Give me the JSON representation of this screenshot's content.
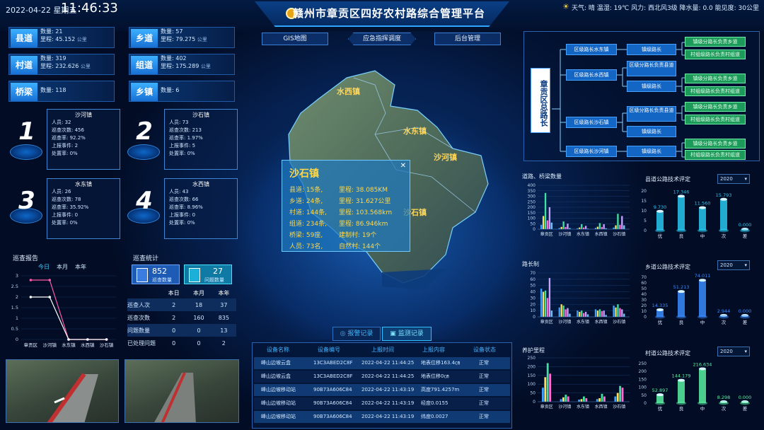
{
  "header": {
    "date": "2022-04-22",
    "weekday": "星期五",
    "time": "11:46:33",
    "title": "赣州市章贡区四好农村路综合管理平台",
    "weather": "天气: 晴  温湿: 19℃  风力: 西北风3级  降水量: 0.0  能见度: 30公里"
  },
  "tabs": [
    {
      "label": "GIS地图"
    },
    {
      "label": "应急指挥调度"
    },
    {
      "label": "后台管理"
    }
  ],
  "stats": [
    {
      "name": "县道",
      "l1": "数量: 21",
      "l2": "里程: 45.152",
      "u": "公里"
    },
    {
      "name": "乡道",
      "l1": "数量: 57",
      "l2": "里程: 79.275",
      "u": "公里"
    },
    {
      "name": "村道",
      "l1": "数量: 319",
      "l2": "里程: 232.626",
      "u": "公里"
    },
    {
      "name": "组道",
      "l1": "数量: 402",
      "l2": "里程: 175.289",
      "u": "公里"
    },
    {
      "name": "桥梁",
      "l1": "数量: 118",
      "l2": "",
      "u": ""
    },
    {
      "name": "乡镇",
      "l1": "数量: 6",
      "l2": "",
      "u": ""
    }
  ],
  "towns": [
    {
      "rank": "1",
      "name": "沙河镇",
      "people": "人员: 32",
      "times": "巡查次数: 456",
      "rate": "巡查率: 92.2%",
      "report": "上报事件: 2",
      "handle": "处置率: 0%"
    },
    {
      "rank": "2",
      "name": "沙石镇",
      "people": "人员: 73",
      "times": "巡查次数: 213",
      "rate": "巡查率: 1.97%",
      "report": "上报事件: 5",
      "handle": "处置率: 0%"
    },
    {
      "rank": "3",
      "name": "水东镇",
      "people": "人员: 26",
      "times": "巡查次数: 78",
      "rate": "巡查率: 35.92%",
      "report": "上报事件: 0",
      "handle": "处置率: 0%"
    },
    {
      "rank": "4",
      "name": "水西镇",
      "people": "人员: 43",
      "times": "巡查次数: 66",
      "rate": "巡查率: 8.96%",
      "report": "上报事件: 0",
      "handle": "处置率: 0%"
    }
  ],
  "patrol_report": {
    "title": "巡查报告",
    "tabs": [
      "今日",
      "本月",
      "本年"
    ],
    "yticks": [
      "3",
      "2.5",
      "2",
      "1.5",
      "1",
      "0.5",
      "0"
    ],
    "categories": [
      "章贡区",
      "沙河镇",
      "水东镇",
      "水西镇",
      "沙石镇"
    ]
  },
  "patrol_stats": {
    "title": "巡查统计",
    "count": "852",
    "count_label": "巡查数量",
    "issues": "27",
    "issues_label": "问题数量",
    "headers": [
      "",
      "本日",
      "本月",
      "本年"
    ],
    "rows": [
      [
        "巡查人次",
        "2",
        "18",
        "37"
      ],
      [
        "巡查次数",
        "2",
        "160",
        "835"
      ],
      [
        "问题数量",
        "0",
        "0",
        "13"
      ],
      [
        "已处理问题",
        "0",
        "0",
        "2"
      ]
    ]
  },
  "map": {
    "labels": [
      "水西镇",
      "水东镇",
      "沙河镇",
      "沙石镇"
    ],
    "popup": {
      "title": "沙石镇",
      "rows": [
        [
          "县道: 15条,",
          "里程: 38.085KM"
        ],
        [
          "乡道: 24条,",
          "里程: 31.627公里"
        ],
        [
          "村道: 144条,",
          "里程: 103.568km"
        ],
        [
          "组道: 234条,",
          "里程: 86.946km"
        ],
        [
          "桥梁: 59座,",
          "建制村: 19个"
        ],
        [
          "人员: 73名,",
          "自然村: 144个"
        ]
      ]
    }
  },
  "records": {
    "tab1": "报警记录",
    "tab2": "监测记录",
    "headers": [
      "设备名称",
      "设备编号",
      "上报时间",
      "上报内容",
      "设备状态"
    ],
    "rows": [
      [
        "峰山边坡云盒",
        "13C3ABED2C8F",
        "2022-04-22 11:44:25",
        "地表位移163.4㎝",
        "正常"
      ],
      [
        "峰山边坡云盒",
        "13C3ABED2C8F",
        "2022-04-22 11:44:25",
        "地表位移0㎝",
        "正常"
      ],
      [
        "峰山边坡移动站",
        "90B73A606C84",
        "2022-04-22 11:43:19",
        "高度791.4257m",
        "正常"
      ],
      [
        "峰山边坡移动站",
        "90B73A606C84",
        "2022-04-22 11:43:19",
        "经度0.0155",
        "正常"
      ],
      [
        "峰山边坡移动站",
        "90B73A606C84",
        "2022-04-22 11:43:19",
        "纬度0.0027",
        "正常"
      ]
    ]
  },
  "org": {
    "root": "章贡区总路长",
    "district": [
      "区级路长水东镇",
      "区级路长水西镇",
      "区级路长沙石镇",
      "区级路长沙河镇"
    ],
    "town": [
      "镇级路长",
      "区级分路长负责县道",
      "镇级路长",
      "区级分路长负责县道",
      "镇级路长",
      "镇级路长"
    ],
    "village": [
      "镇级分路长负责乡道",
      "村组级路长负责村组道",
      "镇级分路长负责乡道",
      "村组级路长负责村组道",
      "镇级分路长负责乡道",
      "村组级路长负责村组道",
      "镇级分路长负责乡道",
      "村组级路长负责村组道"
    ]
  },
  "selects": {
    "year": "2020"
  },
  "chart_data": [
    {
      "type": "bar",
      "title": "道路、桥梁数量",
      "categories": [
        "章贡区",
        "沙河镇",
        "水东镇",
        "水西镇",
        "沙石镇"
      ],
      "ylim": [
        0,
        400
      ],
      "yticks": [
        "400",
        "350",
        "300",
        "250",
        "200",
        "150",
        "100",
        "50",
        "0"
      ],
      "series": [
        {
          "values": [
            40,
            10,
            8,
            12,
            15
          ]
        },
        {
          "values": [
            120,
            20,
            15,
            22,
            35
          ]
        },
        {
          "values": [
            330,
            70,
            45,
            55,
            140
          ]
        },
        {
          "values": [
            80,
            20,
            15,
            20,
            40
          ]
        },
        {
          "values": [
            200,
            50,
            30,
            45,
            120
          ]
        },
        {
          "values": [
            60,
            10,
            5,
            8,
            35
          ]
        }
      ]
    },
    {
      "type": "bar",
      "title": "县道公路技术评定",
      "categories": [
        "优",
        "良",
        "中",
        "次",
        "差"
      ],
      "values": [
        9.73,
        17.346,
        11.56,
        15.793,
        0.0
      ],
      "labels": [
        "9.730",
        "17.346",
        "11.560",
        "15.793",
        "0.000"
      ],
      "yticks": [
        "20",
        "15",
        "10",
        "5",
        "0"
      ],
      "ylim": [
        0,
        20
      ]
    },
    {
      "type": "bar",
      "title": "路长制",
      "categories": [
        "章贡区",
        "沙河镇",
        "水东镇",
        "水西镇",
        "沙石镇"
      ],
      "ylim": [
        0,
        70
      ],
      "yticks": [
        "70",
        "60",
        "50",
        "40",
        "30",
        "20",
        "10",
        "0"
      ],
      "series": [
        {
          "values": [
            45,
            15,
            10,
            12,
            18
          ]
        },
        {
          "values": [
            40,
            20,
            8,
            10,
            15
          ]
        },
        {
          "values": [
            42,
            18,
            10,
            12,
            20
          ]
        },
        {
          "values": [
            30,
            12,
            6,
            9,
            14
          ]
        },
        {
          "values": [
            62,
            14,
            8,
            10,
            12
          ]
        },
        {
          "values": [
            10,
            5,
            4,
            3,
            5
          ]
        }
      ]
    },
    {
      "type": "bar",
      "title": "乡道公路技术评定",
      "categories": [
        "优",
        "良",
        "中",
        "次",
        "差"
      ],
      "values": [
        14.335,
        51.213,
        74.011,
        2.944,
        0.0
      ],
      "labels": [
        "14.335",
        "51.213",
        "74.011",
        "2.944",
        "0.000"
      ],
      "yticks": [
        "70",
        "60",
        "50",
        "40",
        "30",
        "20",
        "10",
        "0"
      ],
      "ylim": [
        0,
        80
      ]
    },
    {
      "type": "bar",
      "title": "养护里程",
      "categories": [
        "章贡区",
        "沙河镇",
        "水东镇",
        "水西镇",
        "沙石镇"
      ],
      "ylim": [
        0,
        250
      ],
      "yticks": [
        "250",
        "200",
        "150",
        "100",
        "50",
        "0"
      ],
      "series": [
        {
          "values": [
            80,
            15,
            12,
            15,
            30
          ]
        },
        {
          "values": [
            140,
            25,
            15,
            20,
            50
          ]
        },
        {
          "values": [
            220,
            40,
            30,
            45,
            90
          ]
        },
        {
          "values": [
            160,
            30,
            20,
            30,
            80
          ]
        }
      ]
    },
    {
      "type": "bar",
      "title": "村道公路技术评定",
      "categories": [
        "优",
        "良",
        "中",
        "次",
        "差"
      ],
      "values": [
        52.897,
        144.179,
        216.634,
        8.298,
        0.0
      ],
      "labels": [
        "52.897",
        "144.179",
        "216.634",
        "8.298",
        "0.000"
      ],
      "yticks": [
        "250",
        "200",
        "150",
        "100",
        "50",
        "0"
      ],
      "ylim": [
        0,
        250
      ]
    }
  ],
  "patrol_line": {
    "series": [
      {
        "values": [
          2.8,
          2.8,
          0,
          0,
          0
        ],
        "color": "#ff5aa8"
      },
      {
        "values": [
          2,
          2,
          0,
          0,
          0
        ],
        "color": "#ffffff"
      }
    ],
    "ylim": [
      0,
      3
    ]
  }
}
